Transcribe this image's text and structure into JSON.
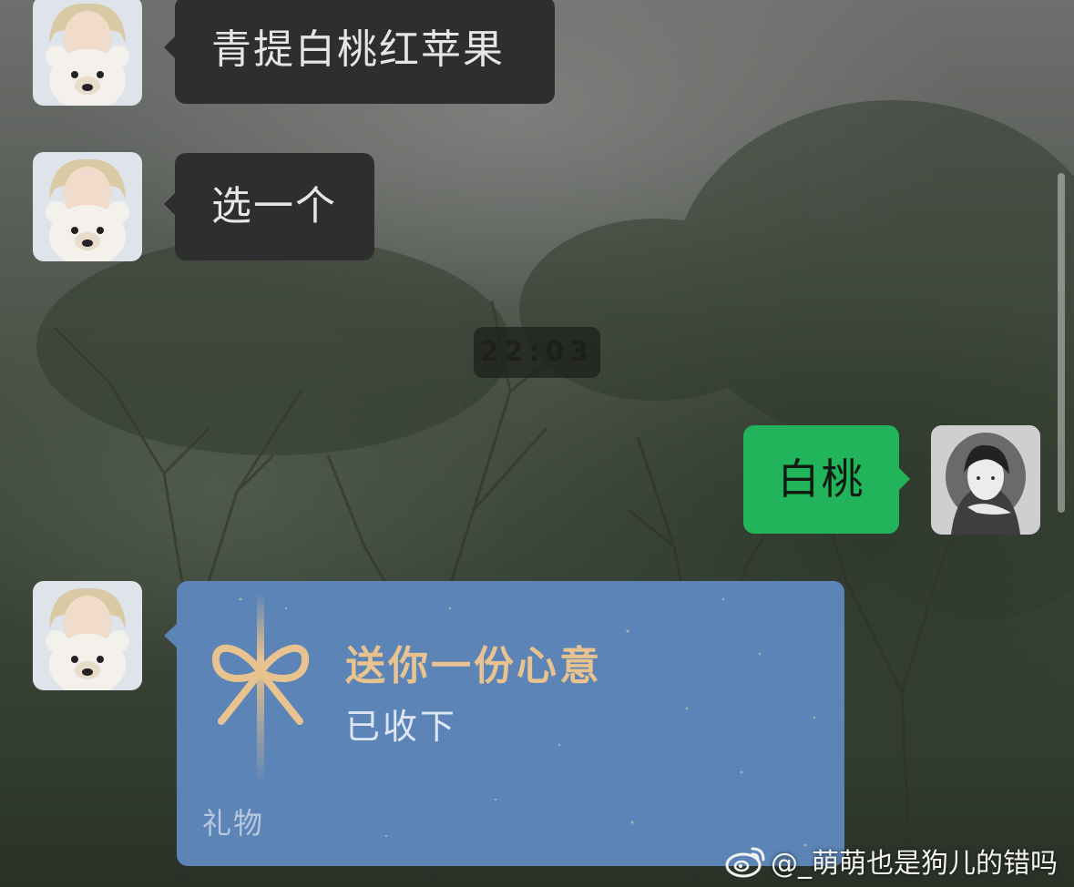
{
  "messages": [
    {
      "sender": "contact",
      "text": "青提白桃红苹果"
    },
    {
      "sender": "contact",
      "text": "选一个"
    }
  ],
  "timestamp": "22:03",
  "reply": {
    "sender": "me",
    "text": "白桃"
  },
  "gift": {
    "title": "送你一份心意",
    "status": "已收下",
    "label": "礼物"
  },
  "watermark": "@_萌萌也是狗儿的错吗",
  "colors": {
    "contact_bubble": "#2e2e2e",
    "my_bubble": "#21b45a",
    "gift_card": "#5c84b6",
    "gift_title": "#e8c38f"
  },
  "icons": [
    "gift-bow-icon",
    "weibo-icon"
  ]
}
